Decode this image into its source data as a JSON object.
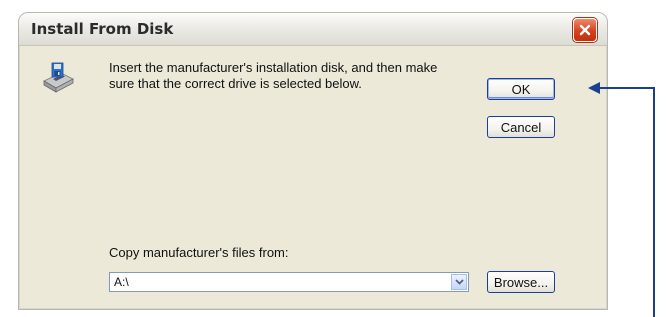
{
  "dialog": {
    "title": "Install From Disk",
    "message": "Insert the manufacturer's installation disk, and then make sure that the correct drive is selected below.",
    "copy_label": "Copy manufacturer's files from:",
    "path_value": "A:\\",
    "buttons": {
      "ok": "OK",
      "cancel": "Cancel",
      "browse": "Browse..."
    }
  },
  "icons": {
    "close": "close-icon",
    "disk": "floppy-drive-icon",
    "dropdown": "chevron-down-icon"
  },
  "colors": {
    "dialog_bg": "#ece9d8",
    "close_red": "#d7401b",
    "button_border": "#1c3f94",
    "callout_arrow": "#1a3f8f"
  }
}
